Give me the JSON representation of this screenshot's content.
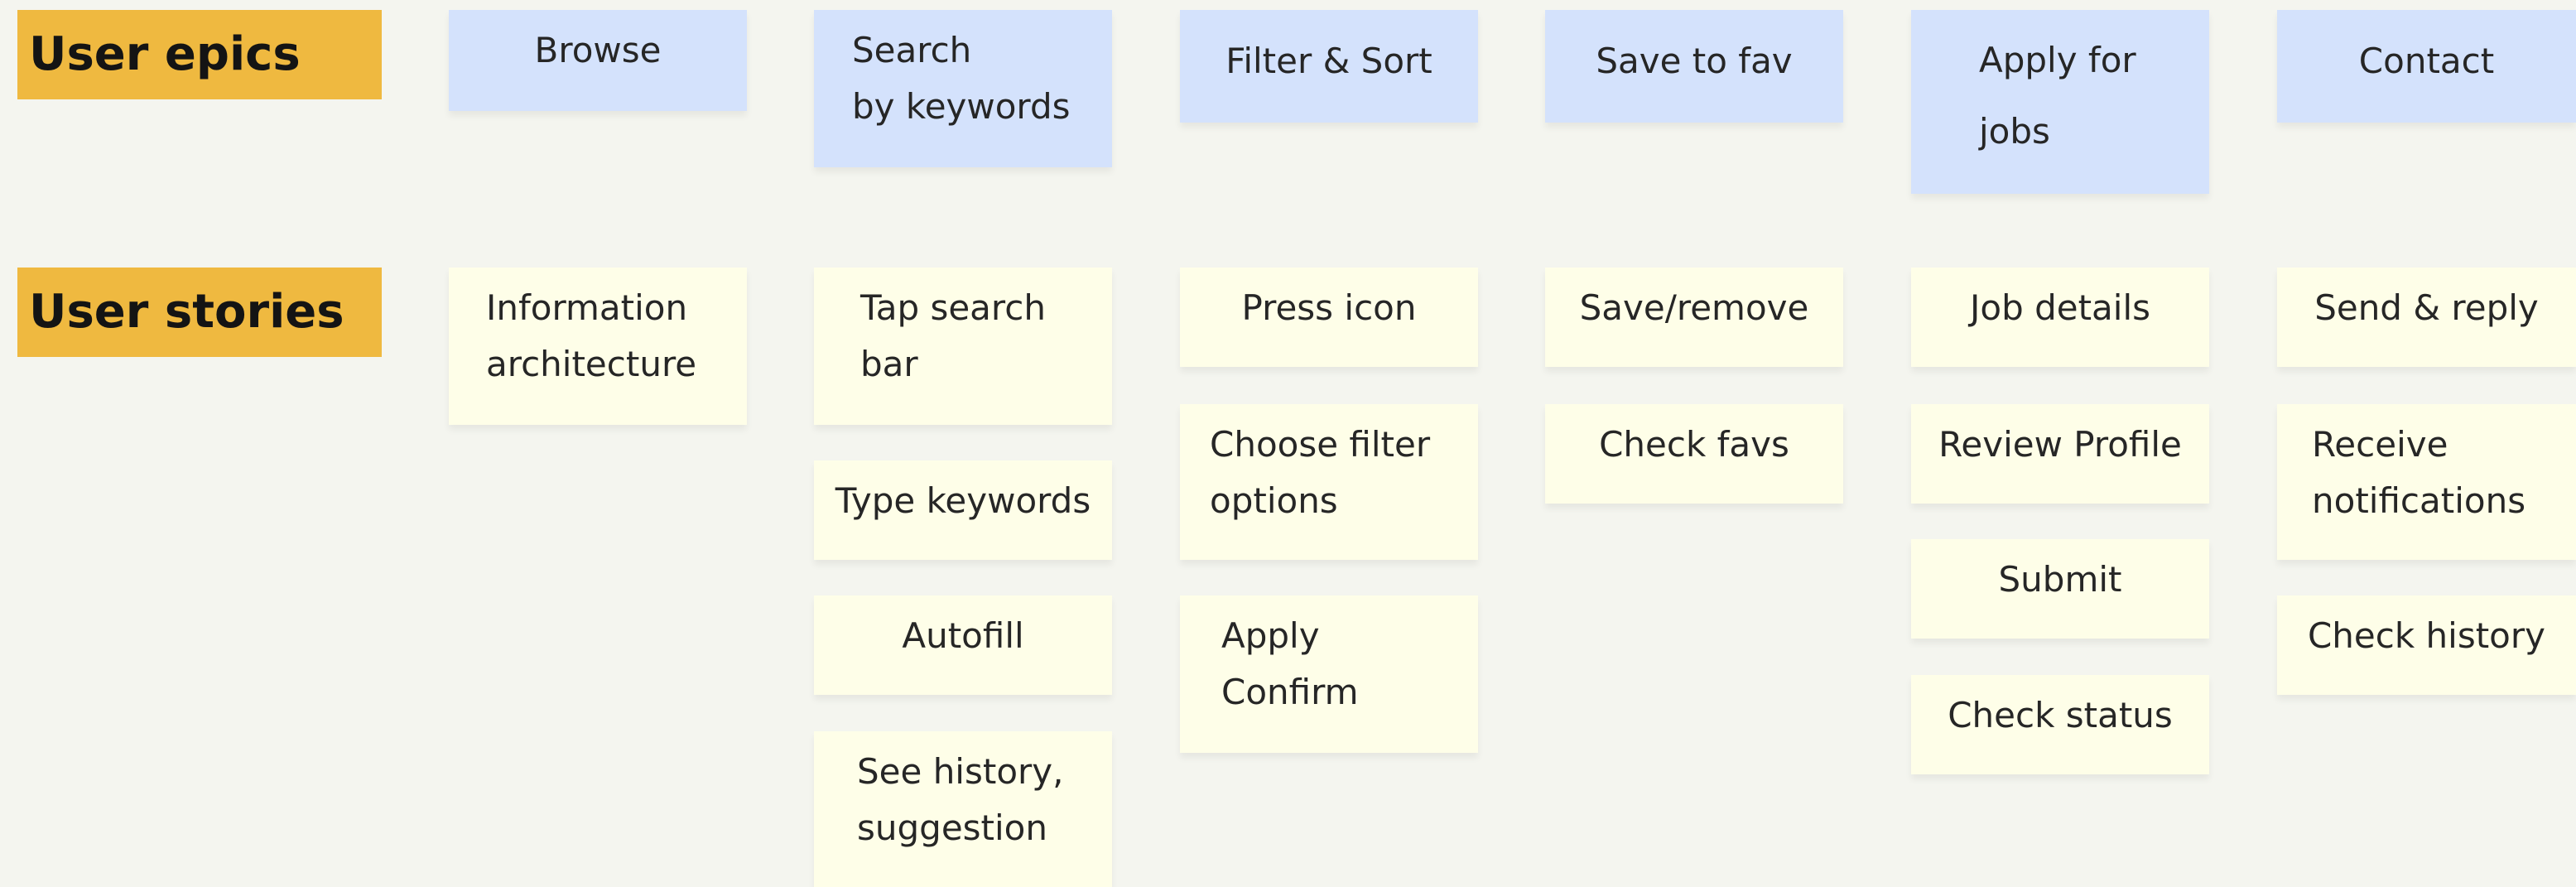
{
  "rows": {
    "epics_label": "User epics",
    "stories_label": "User stories"
  },
  "epics": [
    {
      "text": "Browse"
    },
    {
      "text": "Search\nby keywords"
    },
    {
      "text": "Filter & Sort"
    },
    {
      "text": "Save to fav"
    },
    {
      "text": "Apply for\njobs"
    },
    {
      "text": "Contact"
    }
  ],
  "stories": [
    [
      {
        "text": "Information\narchitecture"
      }
    ],
    [
      {
        "text": "Tap search\nbar"
      },
      {
        "text": "Type keywords"
      },
      {
        "text": "Autofill"
      },
      {
        "text": "See history,\nsuggestion"
      }
    ],
    [
      {
        "text": "Press icon"
      },
      {
        "text": "Choose filter\noptions"
      },
      {
        "text": "Apply\nConfirm"
      }
    ],
    [
      {
        "text": "Save/remove"
      },
      {
        "text": "Check favs"
      }
    ],
    [
      {
        "text": "Job details"
      },
      {
        "text": "Review Profile"
      },
      {
        "text": "Submit"
      },
      {
        "text": "Check status"
      }
    ],
    [
      {
        "text": "Send & reply"
      },
      {
        "text": "Receive\nnotifications"
      },
      {
        "text": "Check history"
      }
    ]
  ],
  "colors": {
    "label_bg": "#efb940",
    "epic_bg": "#d4e2fc",
    "story_bg": "#fefee8",
    "page_bg": "#f4f5ef"
  }
}
